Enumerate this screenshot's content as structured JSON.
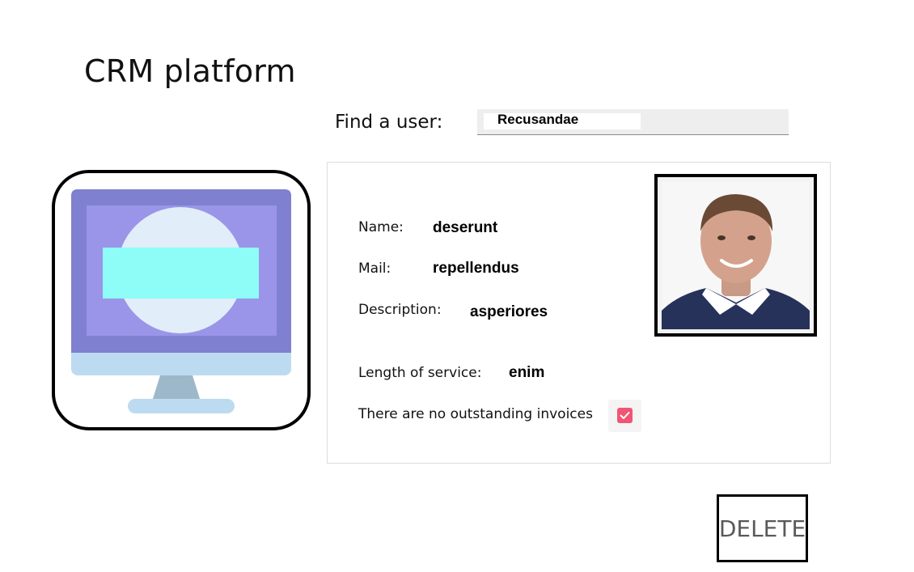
{
  "app": {
    "title": "CRM platform"
  },
  "search": {
    "label": "Find a user:",
    "value": "Recusandae"
  },
  "user": {
    "name_label": "Name:",
    "name_value": "deserunt",
    "mail_label": "Mail:",
    "mail_value": "repellendus",
    "description_label": "Description:",
    "description_value": "asperiores",
    "service_label": "Length of service:",
    "service_value": "enim",
    "invoices_label": "There are no outstanding invoices",
    "invoices_checked": true
  },
  "actions": {
    "delete_label": "DELETE"
  },
  "colors": {
    "monitor_frame": "#7f80d0",
    "monitor_screen": "#9a95e8",
    "monitor_circle": "#e1eefa",
    "monitor_bar": "#8efcf7",
    "monitor_base": "#bddbf0",
    "monitor_stand": "#9db8c9",
    "checkbox": "#f05573"
  },
  "icons": {
    "logo": "monitor-icon",
    "checkbox": "check-icon"
  }
}
